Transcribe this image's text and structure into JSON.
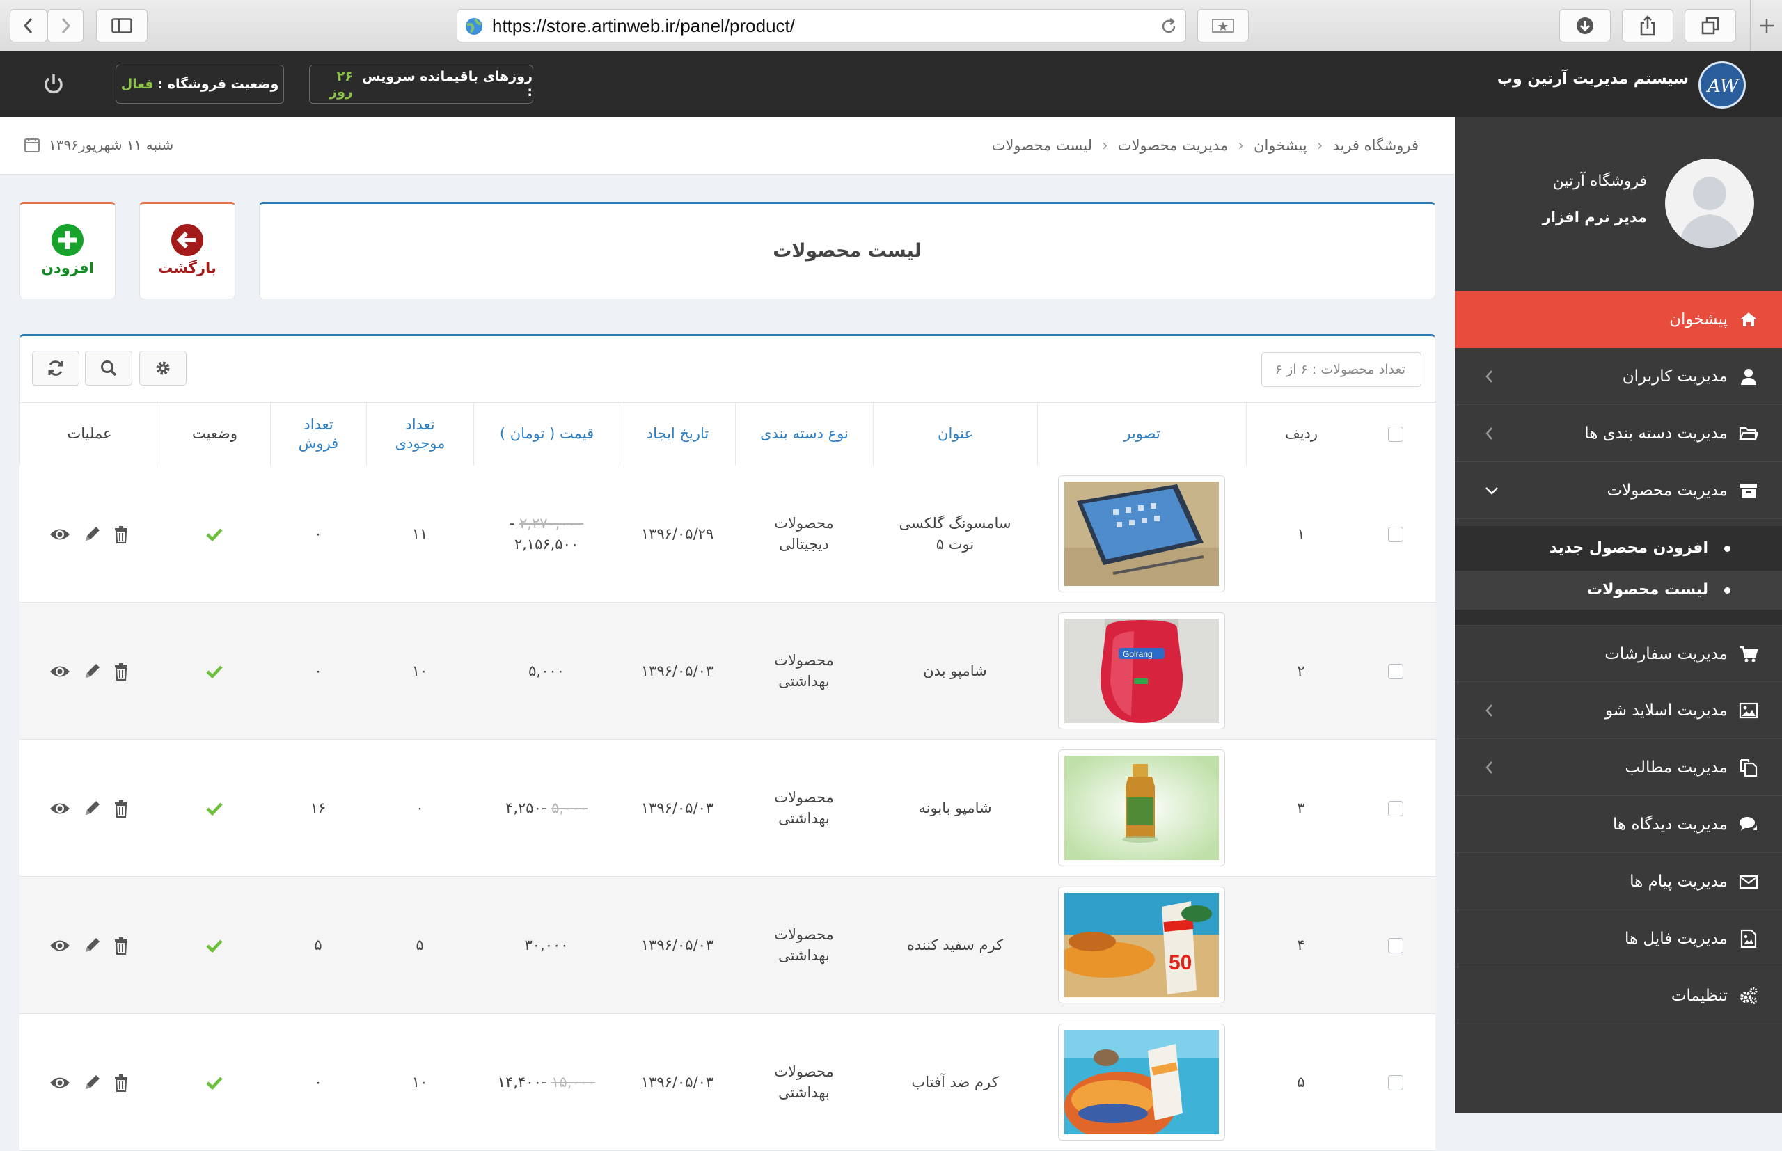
{
  "browser": {
    "url": "https://store.artinweb.ir/panel/product/"
  },
  "topbar": {
    "brand": "سیستم مدیریت آرتین وب",
    "service_label": "روزهای باقیمانده سرویس :",
    "service_value": "۲۶ روز",
    "store_status_label": "وضعیت فروشگاه :",
    "store_status_value": "فعال",
    "status_color": "#8bc34a"
  },
  "sidebar": {
    "store_name": "فروشگاه آرتین",
    "user_role": "مدیر نرم افزار",
    "items": [
      {
        "label": "پیشخوان",
        "icon": "home-icon",
        "active": true
      },
      {
        "label": "مدیریت کاربران",
        "icon": "user-icon"
      },
      {
        "label": "مدیریت دسته بندی ها",
        "icon": "folder-icon"
      },
      {
        "label": "مدیریت محصولات",
        "icon": "archive-icon",
        "open": true
      },
      {
        "label": "مدیریت سفارشات",
        "icon": "cart-icon"
      },
      {
        "label": "مدیریت اسلاید شو",
        "icon": "image-icon"
      },
      {
        "label": "مدیریت مطالب",
        "icon": "copy-icon"
      },
      {
        "label": "مدیریت دیدگاه ها",
        "icon": "comments-icon"
      },
      {
        "label": "مدیریت پیام ها",
        "icon": "envelope-icon"
      },
      {
        "label": "مدیریت فایل ها",
        "icon": "file-image-icon"
      },
      {
        "label": "تنظیمات",
        "icon": "cogs-icon"
      }
    ],
    "submenu": [
      {
        "label": "افزودن محصول جدید"
      },
      {
        "label": "لیست محصولات",
        "current": true
      }
    ],
    "active_color": "#e74c3c"
  },
  "breadcrumb": {
    "items": [
      "فروشگاه فرید",
      "پیشخوان",
      "مدیریت محصولات",
      "لیست محصولات"
    ]
  },
  "date": "شنبه ۱۱ شهریور۱۳۹۶",
  "page": {
    "title": "لیست محصولات",
    "back_label": "بازگشت",
    "add_label": "افزودن",
    "count_label": "تعداد محصولات : ۶ از ۶"
  },
  "table": {
    "headers": {
      "row": "ردیف",
      "image": "تصویر",
      "title": "عنوان",
      "category": "نوع دسته بندی",
      "created": "تاریخ ایجاد",
      "price": "قیمت ( تومان )",
      "stock": "تعداد موجودی",
      "sales": "تعداد فروش",
      "status": "وضعیت",
      "ops": "عملیات"
    },
    "rows": [
      {
        "num": "۱",
        "title": "سامسونگ گلکسی نوت ۵",
        "category": "محصولات دیجیتالی",
        "date": "۱۳۹۶/۰۵/۲۹",
        "price_old": "۲,۲۷۰,۰۰۰",
        "price": "۲,۱۵۶,۵۰۰",
        "stock": "۱۱",
        "sales": "۰",
        "image": "phone-image"
      },
      {
        "num": "۲",
        "title": "شامپو بدن",
        "category": "محصولات بهداشتی",
        "date": "۱۳۹۶/۰۵/۰۳",
        "price_old": "",
        "price": "۵,۰۰۰",
        "stock": "۱۰",
        "sales": "۰",
        "image": "shampoo-bottle-image"
      },
      {
        "num": "۳",
        "title": "شامپو بابونه",
        "category": "محصولات بهداشتی",
        "date": "۱۳۹۶/۰۵/۰۳",
        "price_old": "۵,۰۰۰",
        "price": "۴,۲۵۰",
        "stock": "۰",
        "sales": "۱۶",
        "image": "chamomile-shampoo-image"
      },
      {
        "num": "۴",
        "title": "کرم سفید کننده",
        "category": "محصولات بهداشتی",
        "date": "۱۳۹۶/۰۵/۰۳",
        "price_old": "",
        "price": "۳۰,۰۰۰",
        "stock": "۵",
        "sales": "۵",
        "image": "beach-sunscreen-image"
      },
      {
        "num": "۵",
        "title": "کرم ضد آفتاب",
        "category": "محصولات بهداشتی",
        "date": "۱۳۹۶/۰۵/۰۳",
        "price_old": "۱۵,۰۰۰",
        "price": "۱۴,۴۰۰",
        "stock": "۱۰",
        "sales": "۰",
        "image": "pool-sunscreen-image"
      }
    ],
    "accent_color": "#2f7fc1"
  }
}
